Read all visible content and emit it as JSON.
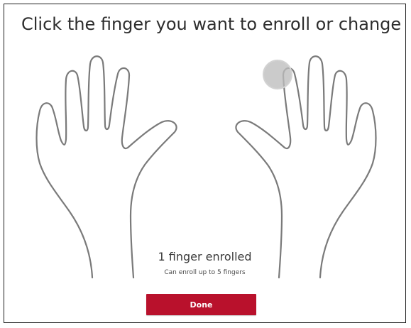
{
  "dialog": {
    "title": "Click the finger you want to enroll or change"
  },
  "hands": {
    "left": {
      "fingers": [
        "thumb",
        "index",
        "middle",
        "ring",
        "pinky"
      ],
      "enrolled": []
    },
    "right": {
      "fingers": [
        "thumb",
        "index",
        "middle",
        "ring",
        "pinky"
      ],
      "enrolled": [
        "index"
      ]
    }
  },
  "status": {
    "enrolled_text": "1 finger enrolled",
    "limit_text": "Can enroll up to 5 fingers"
  },
  "actions": {
    "done_label": "Done"
  },
  "colors": {
    "accent": "#b9112c",
    "outline": "#7a7a7a",
    "enrolled_marker": "#bdbdbd"
  }
}
